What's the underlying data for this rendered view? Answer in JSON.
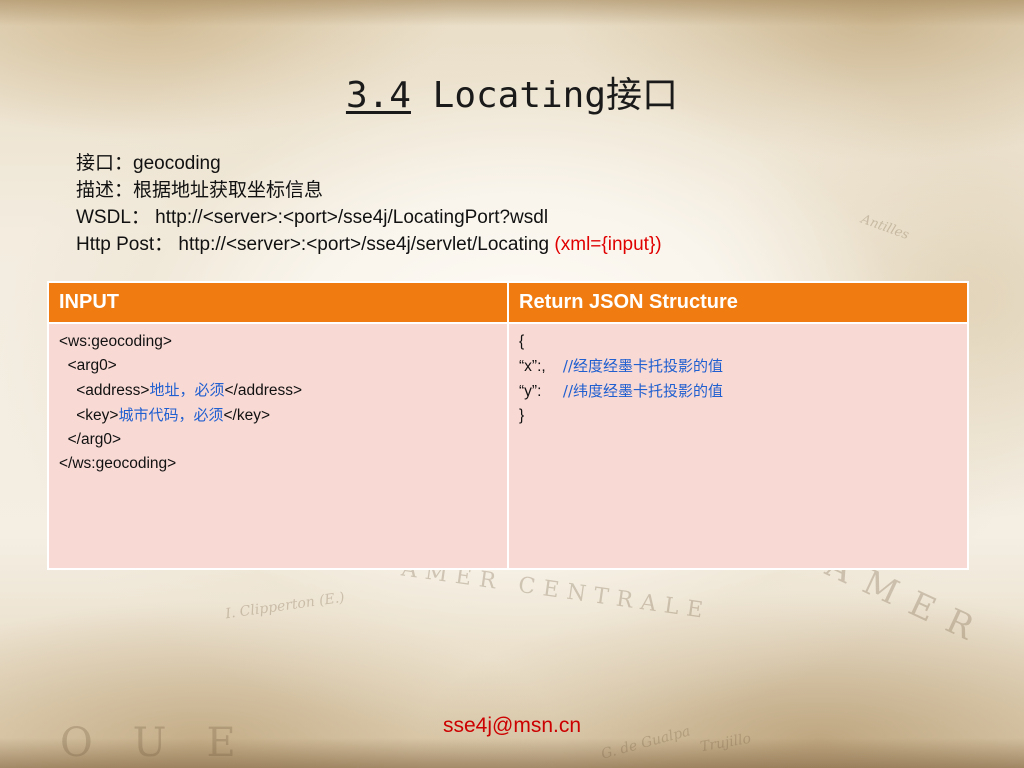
{
  "title": {
    "number": "3.4",
    "text": " Locating接口"
  },
  "info": {
    "interface": "接口：geocoding",
    "description": "描述：根据地址获取坐标信息",
    "wsdl": "WSDL： http://<server>:<port>/sse4j/LocatingPort?wsdl",
    "http_post": "Http Post： http://<server>:<port>/sse4j/servlet/Locating",
    "http_post_param": "(xml={input})"
  },
  "table": {
    "headers": [
      "INPUT",
      "Return JSON Structure"
    ],
    "input_lines": [
      {
        "pre": "<ws:geocoding>",
        "cn": "",
        "post": ""
      },
      {
        "pre": "  <arg0>",
        "cn": "",
        "post": ""
      },
      {
        "pre": "    <address>",
        "cn": "地址，必须",
        "post": "</address>"
      },
      {
        "pre": "    <key>",
        "cn": "城市代码，必须",
        "post": "</key>"
      },
      {
        "pre": "  </arg0>",
        "cn": "",
        "post": ""
      },
      {
        "pre": "</ws:geocoding>",
        "cn": "",
        "post": ""
      }
    ],
    "output_lines": [
      {
        "pre": "{",
        "cn": ""
      },
      {
        "pre": "“x”:,    ",
        "cn": "//经度经墨卡托投影的值"
      },
      {
        "pre": "“y”:     ",
        "cn": "//纬度经墨卡托投影的值"
      },
      {
        "pre": "}",
        "cn": ""
      }
    ]
  },
  "footer": "sse4j@msn.cn"
}
